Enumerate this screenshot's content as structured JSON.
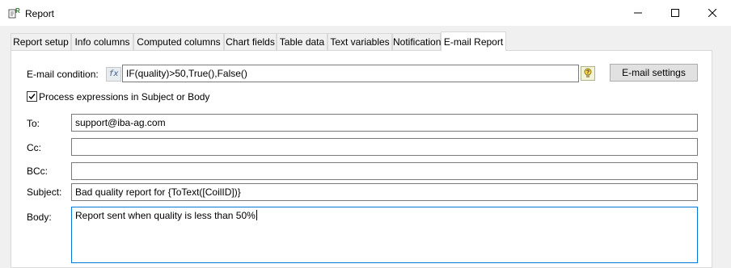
{
  "window": {
    "title": "Report"
  },
  "tabs": [
    {
      "label": "Report setup"
    },
    {
      "label": "Info columns"
    },
    {
      "label": "Computed columns"
    },
    {
      "label": "Chart fields"
    },
    {
      "label": "Table data"
    },
    {
      "label": "Text variables"
    },
    {
      "label": "Notifications"
    },
    {
      "label": "E-mail Report",
      "active": true
    }
  ],
  "email": {
    "condition_label": "E-mail condition:",
    "fx_icon": "fx",
    "condition_value": "IF(quality)>50,True(),False()",
    "settings_button": "E-mail settings",
    "process_expressions_label": "Process expressions in Subject or Body",
    "process_expressions_checked": true,
    "to_label": "To:",
    "to_value": "support@iba-ag.com",
    "cc_label": "Cc:",
    "cc_value": "",
    "bcc_label": "BCc:",
    "bcc_value": "",
    "subject_label": "Subject:",
    "subject_value": "Bad quality report for {ToText([CoilID])}",
    "body_label": "Body:",
    "body_value": "Report sent when quality is less than 50%"
  }
}
